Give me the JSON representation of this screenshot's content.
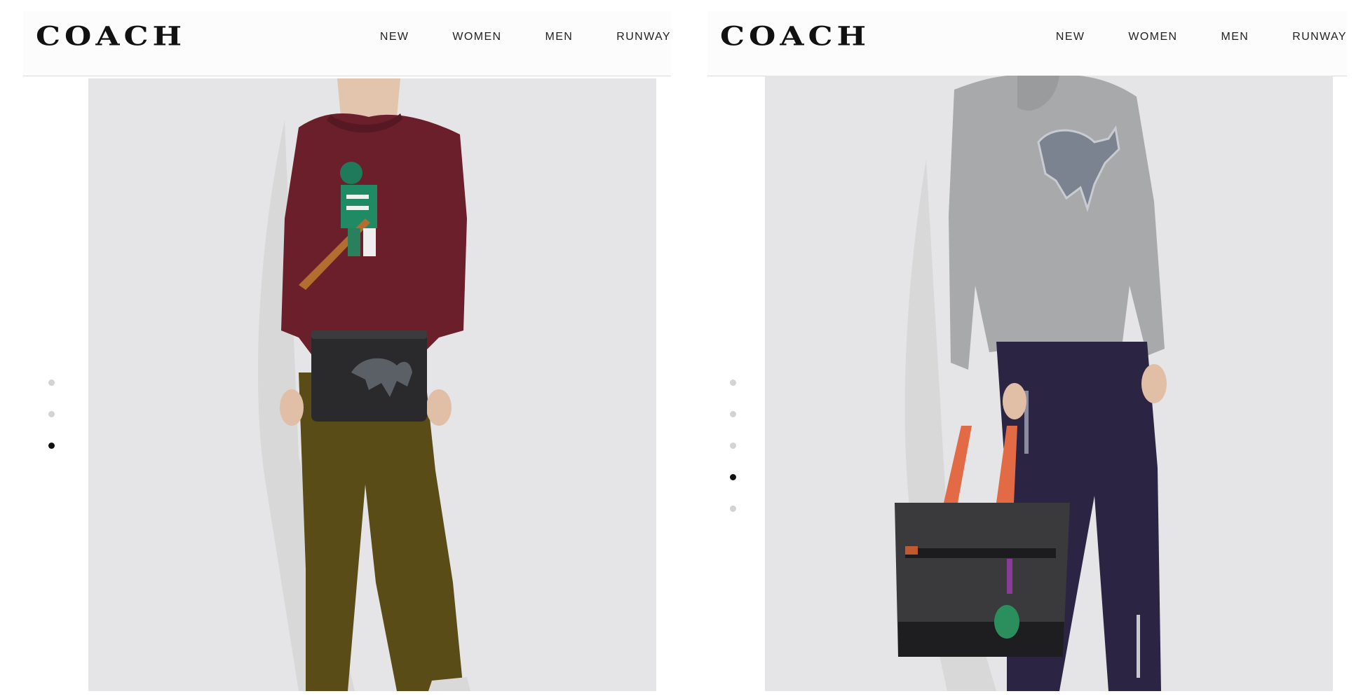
{
  "panels": [
    {
      "brand": "COACH",
      "nav": [
        "NEW",
        "WOMEN",
        "MEN",
        "RUNWAY"
      ],
      "carousel": {
        "total": 3,
        "active_index": 2
      },
      "image_alt": "Model wearing burgundy hockey-player sweater, olive trousers, holding black leather pouch with Rexy dinosaur"
    },
    {
      "brand": "COACH",
      "nav": [
        "NEW",
        "WOMEN",
        "MEN",
        "RUNWAY"
      ],
      "carousel": {
        "total": 5,
        "active_index": 3
      },
      "image_alt": "Model wearing grey Rexy sweatshirt, navy trousers, holding signature canvas tote with orange handles"
    }
  ],
  "colors": {
    "backdrop": "#e5e5e7",
    "dot_inactive": "#d3d3d3",
    "dot_active": "#111111"
  }
}
